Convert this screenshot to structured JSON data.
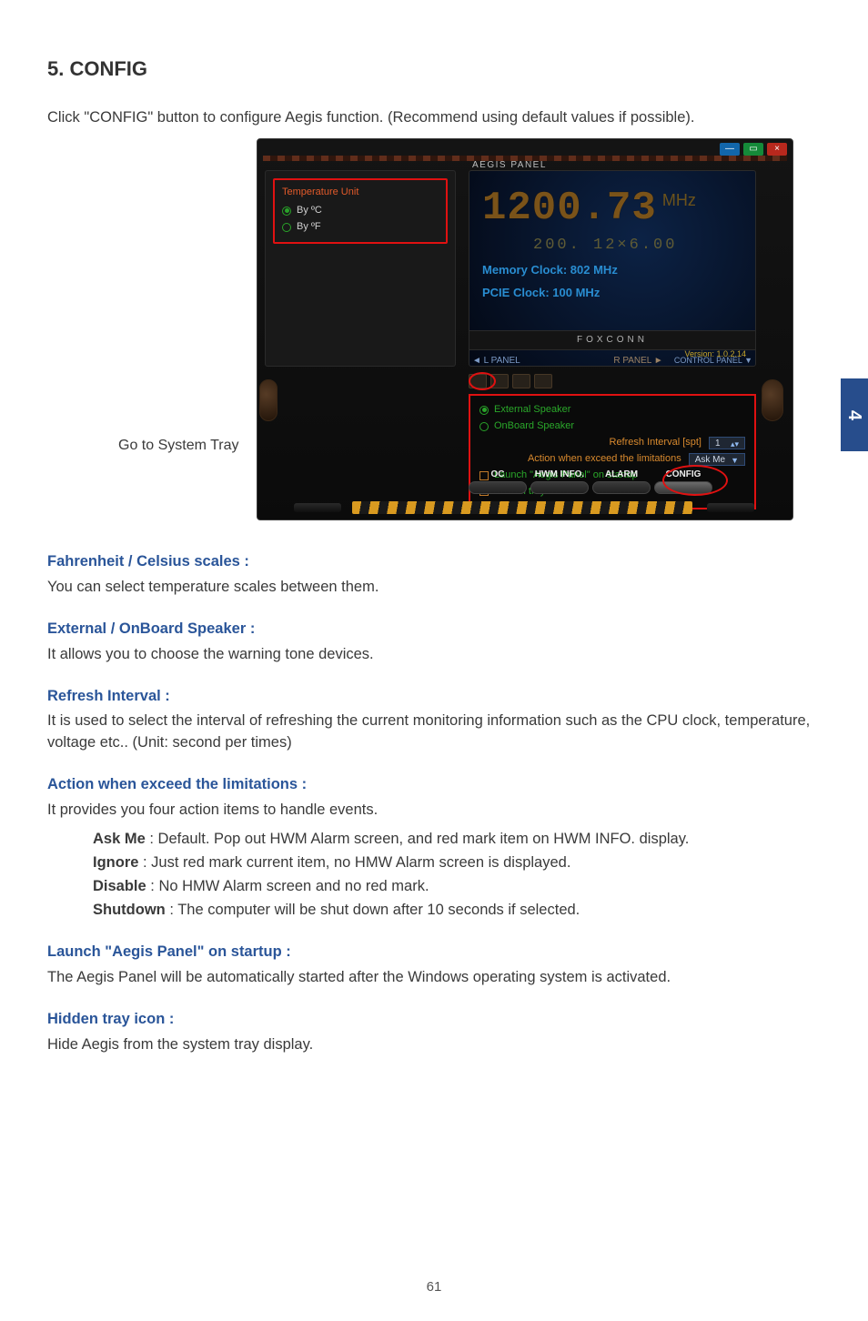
{
  "page_number": "61",
  "side_tab": "4",
  "heading": "5. CONFIG",
  "intro": "Click \"CONFIG\" button to configure Aegis function. (Recommend using default values if possible).",
  "caption_tray": "Go to System Tray",
  "screenshot": {
    "panel_label": "AEGIS PANEL",
    "branding": "FOXCONN",
    "win": {
      "min": "—",
      "res": "▭",
      "close": "×"
    },
    "temp_unit": {
      "title": "Temperature Unit",
      "opt_c": "By ºC",
      "opt_f": "By ºF"
    },
    "readout": {
      "big": "1200.73",
      "unit": "MHz",
      "sub": "200. 12×6.00",
      "mem": "Memory Clock: 802 MHz",
      "pcie": "PCIE Clock: 100 MHz",
      "version": "Version: 1.0.2.14"
    },
    "panel_nav": {
      "l": "◄ L PANEL",
      "r": "R PANEL ►",
      "ctrl": "CONTROL PANEL ▼"
    },
    "config": {
      "ext_spk": "External Speaker",
      "onb_spk": "OnBoard Speaker",
      "refresh_lbl": "Refresh Interval  [spt]",
      "refresh_val": "1",
      "action_lbl": "Action when exceed the limitations",
      "action_val": "Ask Me",
      "launch": "Launch \"Aegis Panel\" on startup",
      "hidden": "Hidden tray icon"
    },
    "tabs": {
      "oc": "OC",
      "hwm": "HWM INFO.",
      "alarm": "ALARM",
      "config": "CONFIG"
    }
  },
  "sections": {
    "fc": {
      "title": "Fahrenheit / Celsius scales :",
      "body": "You can select temperature scales between them."
    },
    "spk": {
      "title": "External / OnBoard Speaker :",
      "body": "It allows you to choose the warning tone devices."
    },
    "ri": {
      "title": "Refresh Interval :",
      "body": "It is used to select the interval of refreshing the current monitoring information such as the CPU clock, temperature, voltage etc.. (Unit: second per times)"
    },
    "act": {
      "title": "Action when exceed the limitations :",
      "body": "It provides you four action items to handle events.",
      "items": {
        "askme_k": "Ask Me",
        "askme_v": " : Default. Pop out HWM Alarm screen, and red mark item on HWM INFO. display.",
        "ignore_k": "Ignore",
        "ignore_v": " :  Just red mark current item, no HMW Alarm screen is displayed.",
        "disable_k": "Disable",
        "disable_v": " :  No HMW Alarm screen and no red mark.",
        "shutdown_k": "Shutdown",
        "shutdown_v": " : The computer will be shut down after 10 seconds if selected."
      }
    },
    "launch": {
      "title": "Launch \"Aegis Panel\" on startup :",
      "body": "The Aegis Panel will be automatically started after the Windows operating system is activated."
    },
    "hidden": {
      "title": "Hidden tray icon :",
      "body": "Hide Aegis from the system tray display."
    }
  }
}
